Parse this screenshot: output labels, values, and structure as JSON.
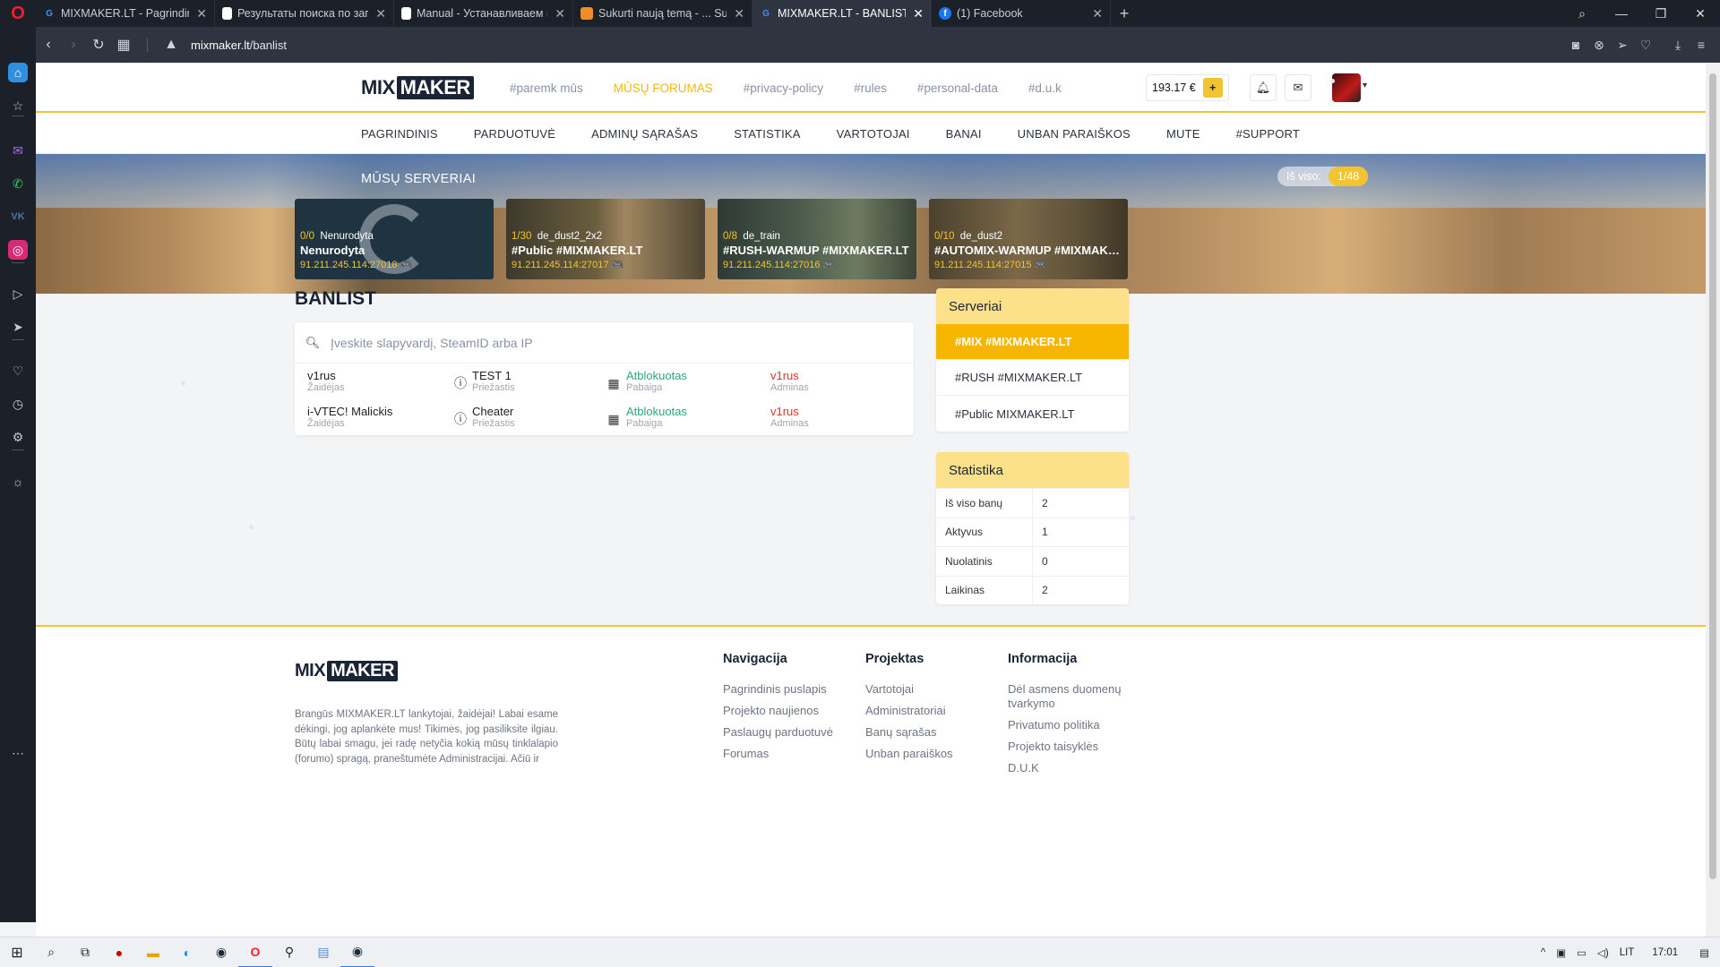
{
  "browser": {
    "tabs": [
      {
        "title": "MIXMAKER.LT - Pagrindinis",
        "favicon": "G",
        "active": false
      },
      {
        "title": "Результаты поиска по запросу",
        "favicon": "doc",
        "active": false
      },
      {
        "title": "Manual - Устанавливаем пла",
        "favicon": "doc",
        "active": false
      },
      {
        "title": "Sukurti naują temą - ... Su",
        "favicon": "cs",
        "active": false
      },
      {
        "title": "MIXMAKER.LT - BANLIST",
        "favicon": "G",
        "active": true
      },
      {
        "title": "(1) Facebook",
        "favicon": "f",
        "active": false
      }
    ],
    "new_tab": "+",
    "url_domain": "mixmaker.lt",
    "url_path": "/banlist"
  },
  "header": {
    "logo_mix": "MIX",
    "logo_maker": "MAKER",
    "topnav": [
      "#paremk mūs",
      "MŪSŲ FORUMAS",
      "#privacy-policy",
      "#rules",
      "#personal-data",
      "#d.u.k"
    ],
    "topnav_active_index": 1,
    "balance": "193.17 €",
    "add_funds": "+"
  },
  "mainnav": [
    "PAGRINDINIS",
    "PARDUOTUVĖ",
    "ADMINŲ SĄRAŠAS",
    "STATISTIKA",
    "VARTOTOJAI",
    "BANAI",
    "UNBAN PARAIŠKOS",
    "MUTE",
    "#SUPPORT"
  ],
  "banner": {
    "title": "MŪSŲ SERVERIAI",
    "total_label": "Iš viso:",
    "total_value": "1/48",
    "servers": [
      {
        "count": "0/0",
        "map": "Nenurodyta",
        "name": "Nenurodyta",
        "ip": "91.211.245.114:27018 🎮"
      },
      {
        "count": "1/30",
        "map": "de_dust2_2x2",
        "name": "#Public #MIXMAKER.LT",
        "ip": "91.211.245.114:27017 🎮"
      },
      {
        "count": "0/8",
        "map": "de_train",
        "name": "#RUSH-WARMUP #MIXMAKER.LT",
        "ip": "91.211.245.114:27016 🎮"
      },
      {
        "count": "0/10",
        "map": "de_dust2",
        "name": "#AUTOMIX-WARMUP #MIXMAKE...",
        "ip": "91.211.245.114:27015 🎮"
      }
    ]
  },
  "banlist": {
    "title": "BANLIST",
    "search_placeholder": "Įveskite slapyvardį, SteamID arba IP",
    "rows": [
      {
        "player": "v1rus",
        "player_label": "Žaidėjas",
        "reason": "TEST 1",
        "reason_label": "Priežastis",
        "end": "Atblokuotas",
        "end_label": "Pabaiga",
        "admin": "v1rus",
        "admin_label": "Adminas"
      },
      {
        "player": "i-VTEC! Malickis",
        "player_label": "Žaidėjas",
        "reason": "Cheater",
        "reason_label": "Priežastis",
        "end": "Atblokuotas",
        "end_label": "Pabaiga",
        "admin": "v1rus",
        "admin_label": "Adminas"
      }
    ]
  },
  "servers_widget": {
    "title": "Serveriai",
    "items": [
      "#MIX #MIXMAKER.LT",
      "#RUSH #MIXMAKER.LT",
      "#Public MIXMAKER.LT"
    ]
  },
  "stats_widget": {
    "title": "Statistika",
    "rows": [
      {
        "k": "Iš viso banų",
        "v": "2"
      },
      {
        "k": "Aktyvus",
        "v": "1"
      },
      {
        "k": "Nuolatinis",
        "v": "0"
      },
      {
        "k": "Laikinas",
        "v": "2"
      }
    ]
  },
  "footer": {
    "about": "Brangūs MIXMAKER.LT lankytojai, žaidėjai! Labai esame dėkingi, jog aplankėte mus! Tikimės, jog pasiliksite ilgiau. Būtų labai smagu, jei radę netyčia kokią mūsų tinklalapio (forumo) spragą, praneštumėte Administracijai. Ačiū ir",
    "columns": [
      {
        "title": "Navigacija",
        "links": [
          "Pagrindinis puslapis",
          "Projekto naujienos",
          "Paslaugų parduotuvė",
          "Forumas"
        ]
      },
      {
        "title": "Projektas",
        "links": [
          "Vartotojai",
          "Administratoriai",
          "Banų sąrašas",
          "Unban paraiškos"
        ]
      },
      {
        "title": "Informacija",
        "links": [
          "Dėl asmens duomenų tvarkymo",
          "Privatumo politika",
          "Projekto taisyklės",
          "D.U.K"
        ]
      }
    ]
  },
  "taskbar": {
    "lang": "LIT",
    "time": "17:01"
  }
}
